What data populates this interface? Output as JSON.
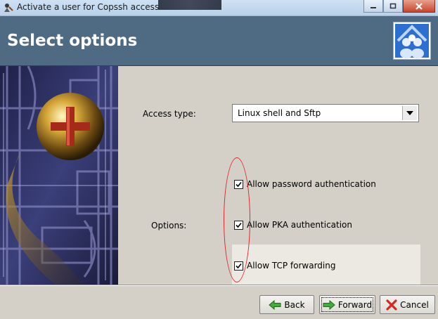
{
  "window": {
    "title": "Activate a user for Copssh access",
    "controls": [
      "minimize",
      "maximize",
      "close"
    ]
  },
  "header": {
    "title": "Select options",
    "logo_icon": "users-logo-icon"
  },
  "form": {
    "access_type_label": "Access type:",
    "access_type_value": "Linux shell and Sftp",
    "options_label": "Options:",
    "options": [
      {
        "label": "Allow password authentication",
        "checked": true
      },
      {
        "label": "Allow PKA authentication",
        "checked": true
      },
      {
        "label": "Allow TCP forwarding",
        "checked": true
      }
    ]
  },
  "buttons": {
    "back": "Back",
    "forward": "Forward",
    "cancel": "Cancel"
  },
  "colors": {
    "header_bg": "#4f6a83",
    "annotation": "#e0282e"
  }
}
